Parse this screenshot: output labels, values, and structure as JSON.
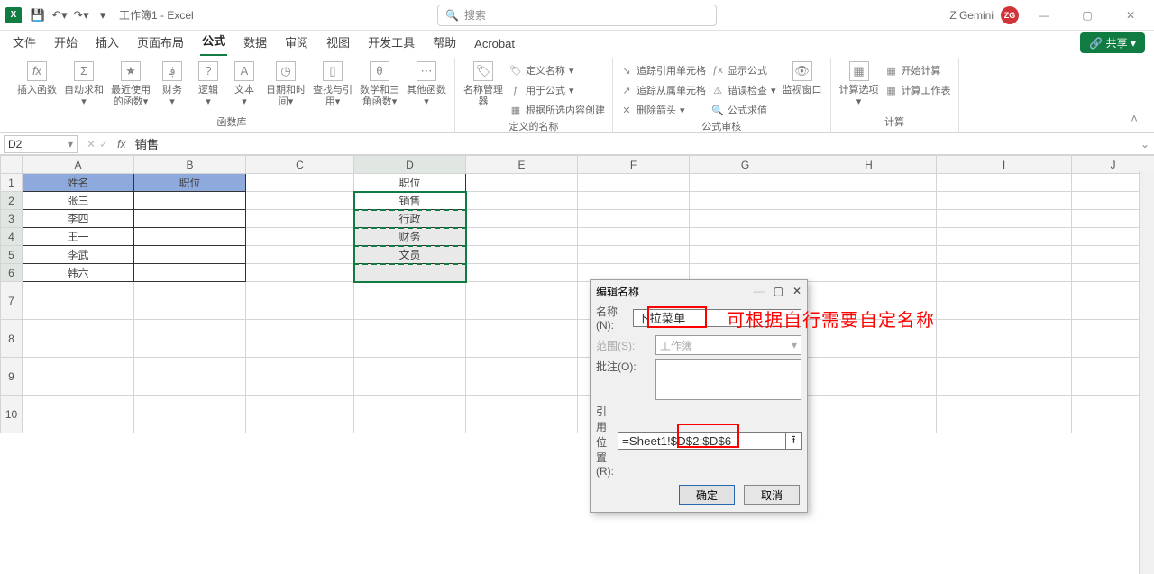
{
  "titlebar": {
    "doc_title": "工作簿1 - Excel",
    "search_placeholder": "搜索",
    "account_name": "Z Gemini",
    "account_initials": "ZG"
  },
  "ribbon": {
    "tabs": [
      "文件",
      "开始",
      "插入",
      "页面布局",
      "公式",
      "数据",
      "审阅",
      "视图",
      "开发工具",
      "帮助",
      "Acrobat"
    ],
    "active_tab": "公式",
    "share": "共享",
    "group1": {
      "label": "函数库",
      "btn_insert_fn": "插入函数",
      "btn_autosum": "自动求和",
      "btn_recent": "最近使用的函数",
      "btn_financial": "财务",
      "btn_logical": "逻辑",
      "btn_text": "文本",
      "btn_date": "日期和时间",
      "btn_lookup": "查找与引用",
      "btn_math": "数学和三角函数",
      "btn_more": "其他函数"
    },
    "group2": {
      "label": "定义的名称",
      "btn_namemgr": "名称管理器",
      "row_define": "定义名称",
      "row_useformula": "用于公式",
      "row_createfromsel": "根据所选内容创建"
    },
    "group3": {
      "label": "公式审核",
      "row_trace_prec": "追踪引用单元格",
      "row_trace_dep": "追踪从属单元格",
      "row_remove_arrows": "删除箭头",
      "row_showformulas": "显示公式",
      "row_errorcheck": "错误检查",
      "row_evalformula": "公式求值",
      "btn_watch": "监视窗口"
    },
    "group4": {
      "label": "计算",
      "btn_calcoptions": "计算选项",
      "row_calcnow": "开始计算",
      "row_calcsheet": "计算工作表"
    }
  },
  "formula_bar": {
    "name_box": "D2",
    "formula_value": "销售"
  },
  "grid": {
    "cols": [
      "A",
      "B",
      "C",
      "D",
      "E",
      "F",
      "G",
      "H",
      "I",
      "J"
    ],
    "header_row": {
      "a": "姓名",
      "b": "职位",
      "d": "职位"
    },
    "d_vals": [
      "销售",
      "行政",
      "财务",
      "文员",
      ""
    ],
    "a_vals": [
      "张三",
      "李四",
      "王一",
      "李武",
      "韩六"
    ],
    "row_count": 10,
    "selected_range": "D2:D6"
  },
  "dialog": {
    "title": "编辑名称",
    "name_label": "名称(N):",
    "name_value": "下拉菜单",
    "scope_label": "范围(S):",
    "scope_value": "工作簿",
    "comment_label": "批注(O):",
    "refersto_label": "引用位置(R):",
    "refersto_value": "=Sheet1!$D$2:$D$6",
    "ok": "确定",
    "cancel": "取消"
  },
  "annotation_text": "可根据自行需要自定名称"
}
